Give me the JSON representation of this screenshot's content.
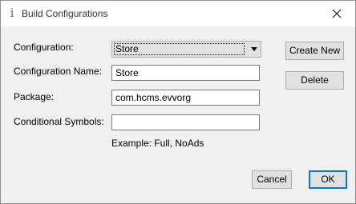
{
  "window": {
    "title": "Build Configurations",
    "app_icon": "info-i-icon",
    "close_icon": "close-icon"
  },
  "form": {
    "configuration": {
      "label": "Configuration:",
      "value": "Store"
    },
    "configuration_name": {
      "label": "Configuration Name:",
      "value": "Store"
    },
    "package": {
      "label": "Package:",
      "value": "com.hcms.evvorg"
    },
    "conditional_symbols": {
      "label": "Conditional Symbols:",
      "value": "",
      "hint": "Example: Full, NoAds"
    }
  },
  "buttons": {
    "create_new": "Create New",
    "delete": "Delete",
    "cancel": "Cancel",
    "ok": "OK"
  },
  "colors": {
    "focus_border": "#0078d7",
    "button_face": "#e1e1e1",
    "dialog_background": "#f0f0f0"
  }
}
